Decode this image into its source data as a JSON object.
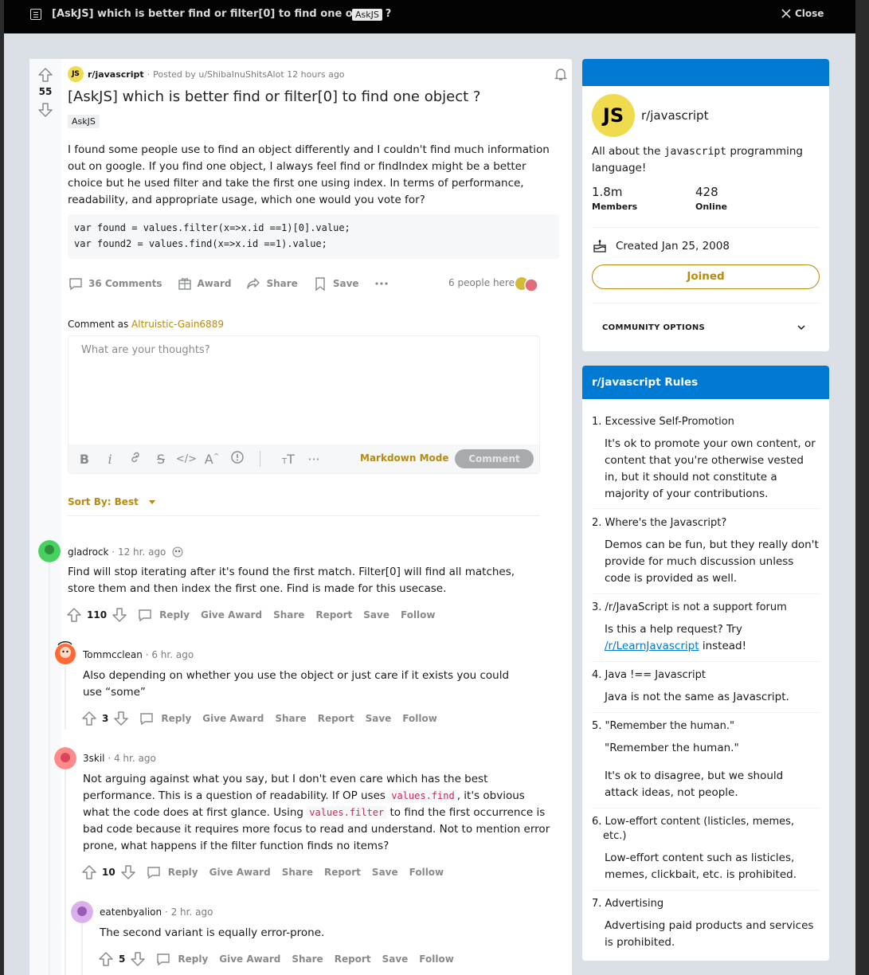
{
  "topbar": {
    "title": "[AskJS] which is better find or filter[0] to find one object ?",
    "flair": "AskJS",
    "close_label": "Close"
  },
  "post": {
    "votes": "55",
    "subreddit": "r/javascript",
    "posted_by": "Posted by u/ShibaInuShitsAlot",
    "time": "12 hours ago",
    "title": "[AskJS] which is better find or filter[0] to find one object ?",
    "flair": "AskJS",
    "body": "I found some people use to find an object differently and I couldn't find much information out on google. If you find one object, I always feel find or findIndex might be a better choice but he used filter and take the first one using index. In terms of performance, readability, and appropriate usage, which one would you vote for?",
    "code_lines": [
      "var found = values.filter(x=>x.id ==1)[0].value;",
      "var found2 = values.find(x=>x.id ==1).value;"
    ],
    "actions": {
      "comments": "36 Comments",
      "award": "Award",
      "share": "Share",
      "save": "Save",
      "people_here": "6 people here"
    }
  },
  "composer": {
    "comment_as_label": "Comment as",
    "username": "Altruistic-Gain6889",
    "placeholder": "What are your thoughts?",
    "markdown_mode": "Markdown Mode",
    "comment_button": "Comment"
  },
  "sort": {
    "label": "Sort By: Best"
  },
  "comments": [
    {
      "user": "gladrock",
      "time": "12 hr. ago",
      "text": "Find will stop iterating after it's found the first match. Filter[0] will find all matches, store them and then index the first one. Find is made for this usecase.",
      "votes": "110",
      "avatar_color": "#46d160"
    },
    {
      "user": "Tommcclean",
      "time": "6 hr. ago",
      "text": "Also depending on whether you use the object or just care if it exists you could use “some”",
      "votes": "3",
      "avatar_color": "#ff4500"
    },
    {
      "user": "3skil",
      "time": "4 hr. ago",
      "text_a": "Not arguing against what you say, but I don't even care which has the best performance. This is a question of readability. If OP uses",
      "code_a": "values.find",
      "text_b": ", it's obvious what the code does at first glance. Using",
      "code_b": "values.filter",
      "text_c": "to find the first occurrence is bad code because it requires more focus to read and understand. Not to mention error prone, what happens if the filter function finds no items?",
      "votes": "10",
      "avatar_color": "#ff585b"
    },
    {
      "user": "eatenbyalion",
      "time": "2 hr. ago",
      "text": "The second variant is equally error-prone.",
      "votes": "5",
      "avatar_color": "#c18ad9"
    }
  ],
  "comment_actions": {
    "reply": "Reply",
    "give_award": "Give Award",
    "share": "Share",
    "report": "Report",
    "save": "Save",
    "follow": "Follow"
  },
  "sidebar": {
    "sub_name": "r/javascript",
    "avatar_text": "JS",
    "about_a": "All about the",
    "about_code": "javascript",
    "about_b": "programming language!",
    "members_value": "1.8m",
    "members_label": "Members",
    "online_value": "428",
    "online_label": "Online",
    "created": "Created Jan 25, 2008",
    "joined_button": "Joined",
    "community_options": "COMMUNITY OPTIONS",
    "accent": "#0079d3",
    "js_yellow": "#f0db4f"
  },
  "rules": {
    "header": "r/javascript Rules",
    "items": [
      {
        "num": "1.",
        "title": "Excessive Self-Promotion",
        "desc": "It's ok to promote your own content, or content that you're otherwise vested in, but it should not constitute a majority of your contributions."
      },
      {
        "num": "2.",
        "title": "Where's the Javascript?",
        "desc": "Demos can be fun, but they really don't provide for much discussion unless code is provided as well."
      },
      {
        "num": "3.",
        "title": "/r/JavaScript is not a support forum",
        "desc_a": "Is this a help request? Try",
        "desc_link": "/r/LearnJavascript",
        "desc_b": "instead!"
      },
      {
        "num": "4.",
        "title": "Java !== Javascript",
        "desc": "Java is not the same as Javascript."
      },
      {
        "num": "5.",
        "title": "\"Remember the human.\"",
        "desc": "\"Remember the human.\"",
        "desc2": "It's ok to disagree, but we should attack ideas, not people."
      },
      {
        "num": "6.",
        "title": "Low-effort content (listicles, memes, etc.)",
        "desc": "Low-effort content such as listicles, memes, clickbait, etc. is prohibited."
      },
      {
        "num": "7.",
        "title": "Advertising",
        "desc": "Advertising paid products and services is prohibited."
      }
    ]
  }
}
